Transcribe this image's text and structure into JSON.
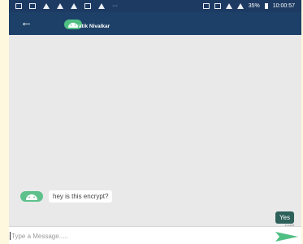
{
  "statusbar": {
    "battery": "35%",
    "time": "10:00:57",
    "more": "···"
  },
  "toolbar": {
    "contact_name": "Pratik Nivalkar"
  },
  "messages": {
    "incoming_text": "hey is this encrypt?",
    "outgoing_text": "Yes",
    "outgoing_status": "sent"
  },
  "composer": {
    "placeholder": "Type a Message....."
  },
  "colors": {
    "statusbar": "#1d3a63",
    "toolbar": "#1d4068",
    "avatar": "#4fbf83",
    "outgoing_bubble": "#2c6059",
    "send": "#4fbf83"
  }
}
